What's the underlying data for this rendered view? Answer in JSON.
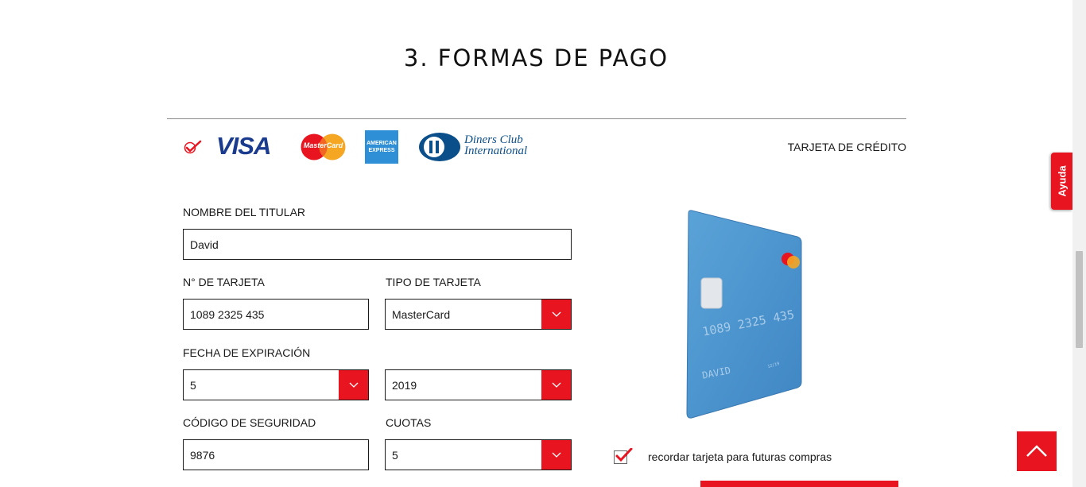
{
  "section": {
    "title": "3. FORMAS DE PAGO"
  },
  "payment": {
    "method_label": "TARJETA DE CRÉDITO",
    "brands": {
      "visa": "VISA",
      "mastercard": "MasterCard",
      "amex_line1": "AMERICAN",
      "amex_line2": "EXPRESS",
      "diners_line1": "Diners Club",
      "diners_line2": "International"
    }
  },
  "form": {
    "holder_label": "NOMBRE DEL TITULAR",
    "holder_value": "David",
    "card_number_label": "N° DE TARJETA",
    "card_number_value": "1089 2325 435",
    "card_type_label": "TIPO DE TARJETA",
    "card_type_value": "MasterCard",
    "expiry_label": "FECHA DE EXPIRACIÓN",
    "expiry_month_value": "5",
    "expiry_year_value": "2019",
    "security_label": "CÓDIGO DE SEGURIDAD",
    "security_value": "9876",
    "installments_label": "CUOTAS",
    "installments_value": "5"
  },
  "card_preview": {
    "number": "1089  2325  435",
    "name": "DAVID",
    "brand": "MasterCard"
  },
  "remember": {
    "label": "recordar tarjeta para futuras compras",
    "checked": true
  },
  "help": {
    "label": "Ayuda"
  },
  "colors": {
    "accent": "#e8141f",
    "card_blue": "#4d95cf"
  }
}
